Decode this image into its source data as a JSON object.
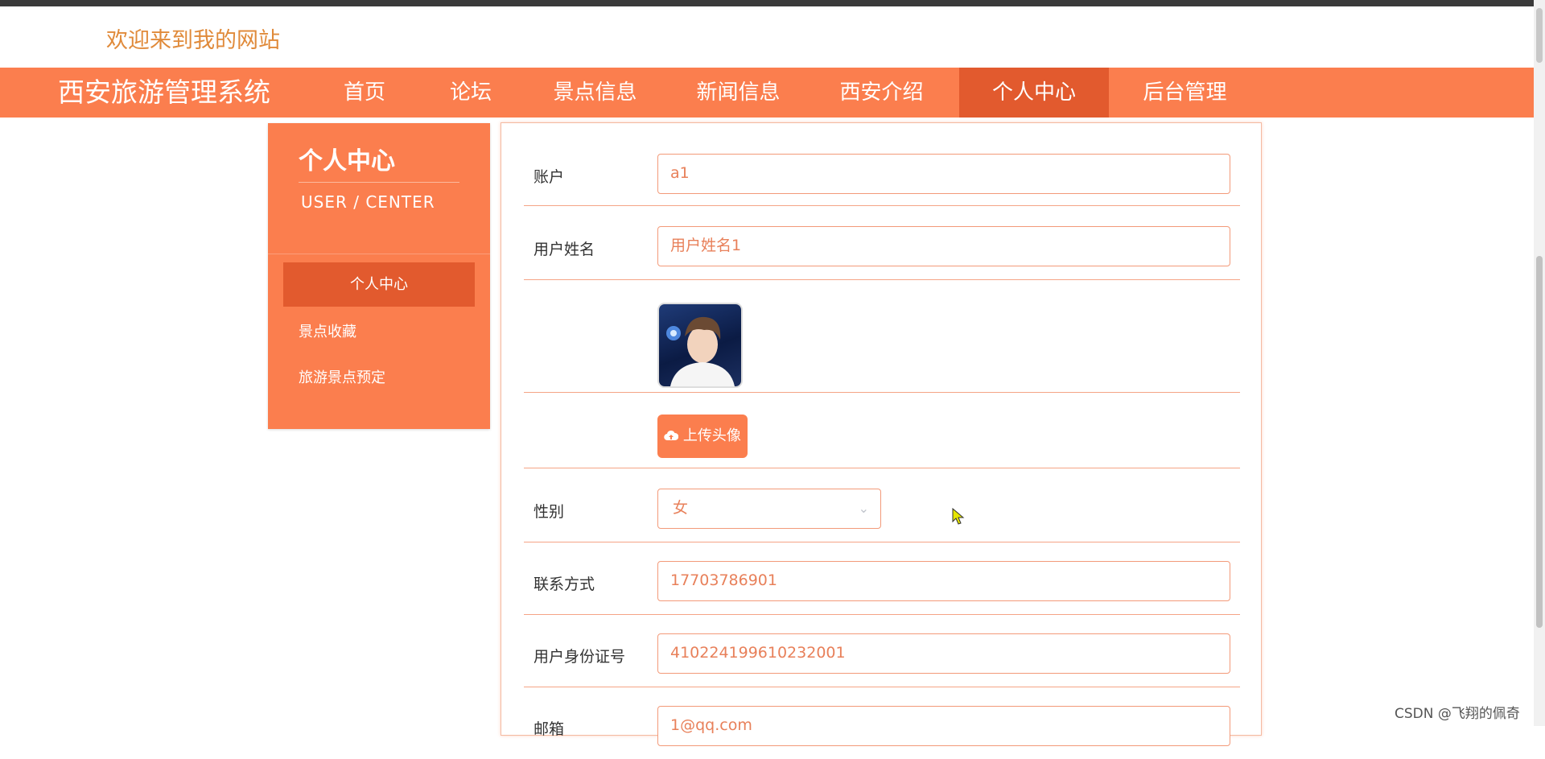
{
  "header": {
    "welcome": "欢迎来到我的网站"
  },
  "navbar": {
    "brand": "西安旅游管理系统",
    "items": [
      "首页",
      "论坛",
      "景点信息",
      "新闻信息",
      "西安介绍",
      "个人中心",
      "后台管理"
    ],
    "active": "个人中心"
  },
  "sidebar": {
    "title": "个人中心",
    "subtitle": "USER / CENTER",
    "items": [
      "个人中心",
      "景点收藏",
      "旅游景点预定"
    ]
  },
  "form": {
    "account_label": "账户",
    "account_value": "a1",
    "name_label": "用户姓名",
    "name_value": "用户姓名1",
    "upload_label": "上传头像",
    "gender_label": "性别",
    "gender_value": "女",
    "phone_label": "联系方式",
    "phone_value": "17703786901",
    "id_label": "用户身份证号",
    "id_value": "410224199610232001",
    "email_label": "邮箱",
    "email_value": "1@qq.com"
  },
  "watermark": "CSDN @飞翔的佩奇",
  "icons": {
    "upload": "cloud-upload-icon",
    "chevron": "chevron-down-icon",
    "cursor": "mouse-pointer-icon"
  },
  "colors": {
    "accent": "#fb7e4e",
    "accent_dark": "#e25a2e",
    "welcome": "#e08a3a"
  }
}
